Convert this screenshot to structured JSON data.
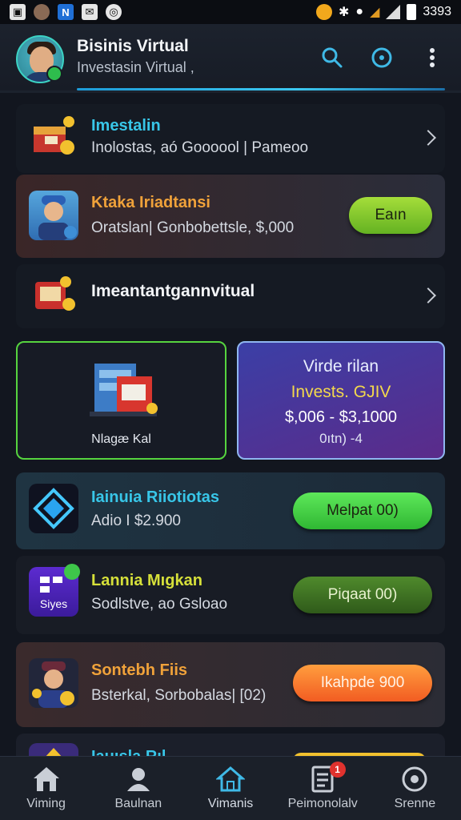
{
  "status_bar": {
    "left_icons": [
      "photo-icon",
      "avatar-icon",
      "app-icon",
      "mail-icon",
      "shield-icon"
    ],
    "time": "3393",
    "colors": {
      "coin": "#f2a81c"
    }
  },
  "app_bar": {
    "title": "Bisinis Virtual",
    "subtitle": "Investasin Virtual ,",
    "actions": [
      "search-icon",
      "compass-icon",
      "more-icon"
    ],
    "accent": "#3cc8f0"
  },
  "rows": [
    {
      "title": "Imestalin",
      "subtitle": "Inolostas, aó Goooool | Pameoo",
      "icon": "treasure-chest-icon",
      "has_chevron": true,
      "title_color": "#38c6e8"
    },
    {
      "title": "Ktaka Iriadtansi",
      "subtitle": "Oratslan| Gonbobettsle, $,000",
      "icon": "worker-avatar-icon",
      "button": "Eaın",
      "title_color": "#f0a23a"
    },
    {
      "title": "Imeantantgannvitual",
      "icon": "treasure-box-icon",
      "has_chevron": true
    }
  ],
  "promo": {
    "left_label": "Nlagæ Kal",
    "left_icon": "store-building-icon",
    "right_line1": "Virde rilan",
    "right_line2": "Invests. GJIV",
    "right_line3": "$,006 - $3,1000",
    "right_line4": "0ıtn) -4"
  },
  "business": [
    {
      "title": "Iainuia Riiotiotas",
      "subtitle": "Adio I $2.900",
      "icon": "diamond-icon",
      "button": "Melpat 00)",
      "title_color": "#38c6e8",
      "button_color": "#3fd24a"
    },
    {
      "title": "Lannia Mıgkan",
      "subtitle": "Sodlstve, ao Gsloao",
      "icon": "sites-icon",
      "icon_label": "Siyes",
      "button": "Piqaat 00)",
      "title_color": "#d6e03a",
      "button_color": "#3e6b23"
    },
    {
      "title": "Sontebh Fiis",
      "subtitle": "Bsterkal, Sorbobalas| [02)",
      "icon": "businessman-icon",
      "button": "Ikahpde 900",
      "title_color": "#f0a23a",
      "button_color": "#ff7a2c"
    },
    {
      "title": "Iauısla Rıl",
      "icon": "gold-bar-icon"
    }
  ],
  "nav": [
    {
      "label": "Viming",
      "icon": "home-icon"
    },
    {
      "label": "Baulnan",
      "icon": "person-icon"
    },
    {
      "label": "Vimanis",
      "icon": "house-outline-icon",
      "active": true
    },
    {
      "label": "Peimonolalv",
      "icon": "document-icon",
      "badge": "1"
    },
    {
      "label": "Srenne",
      "icon": "record-icon"
    }
  ]
}
